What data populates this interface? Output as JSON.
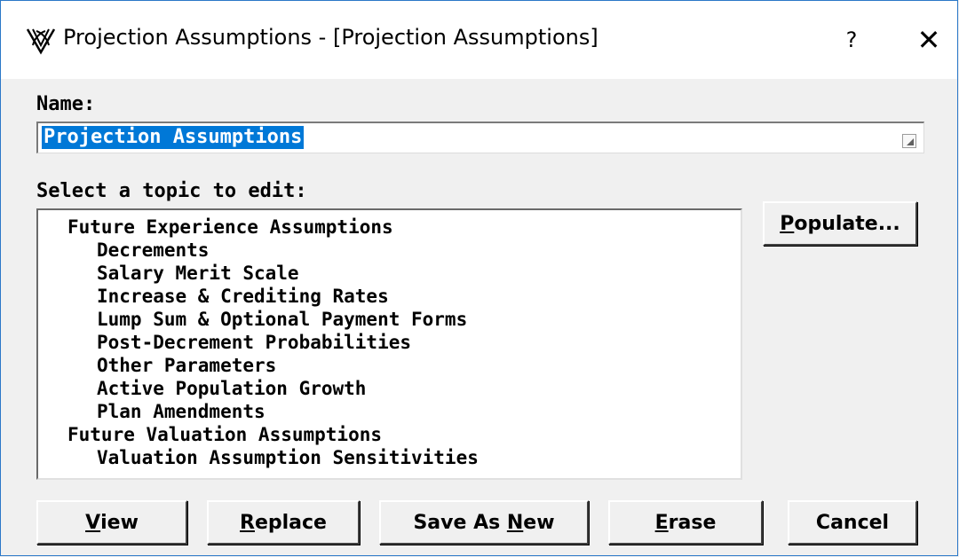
{
  "window": {
    "title": "Projection Assumptions - [Projection Assumptions]",
    "help_label": "?",
    "close_label": "✕"
  },
  "name_section": {
    "label": "Name:",
    "value": "Projection Assumptions"
  },
  "topic_section": {
    "label": "Select a topic to edit:",
    "items": [
      {
        "label": "Future Experience Assumptions",
        "level": 0
      },
      {
        "label": "Decrements",
        "level": 1
      },
      {
        "label": "Salary Merit Scale",
        "level": 1
      },
      {
        "label": "Increase & Crediting Rates",
        "level": 1
      },
      {
        "label": "Lump Sum & Optional Payment Forms",
        "level": 1
      },
      {
        "label": "Post-Decrement Probabilities",
        "level": 1
      },
      {
        "label": "Other Parameters",
        "level": 1
      },
      {
        "label": "Active Population Growth",
        "level": 1
      },
      {
        "label": "Plan Amendments",
        "level": 1
      },
      {
        "label": "Future Valuation Assumptions",
        "level": 0
      },
      {
        "label": "Valuation Assumption Sensitivities",
        "level": 1
      }
    ]
  },
  "buttons": {
    "populate": {
      "pre": "",
      "mnemonic": "P",
      "post": "opulate..."
    },
    "view": {
      "pre": "",
      "mnemonic": "V",
      "post": "iew"
    },
    "replace": {
      "pre": "",
      "mnemonic": "R",
      "post": "eplace"
    },
    "save_as_new": {
      "pre": "Save As ",
      "mnemonic": "N",
      "post": "ew"
    },
    "erase": {
      "pre": "",
      "mnemonic": "E",
      "post": "rase"
    },
    "cancel": {
      "pre": "Cancel",
      "mnemonic": "",
      "post": ""
    }
  },
  "colors": {
    "selection": "#0078d7",
    "window_border": "#2b78c8",
    "dialog_background": "#f0f0f0"
  },
  "icons": {
    "app": "app-logo-icon",
    "help": "help-icon",
    "close": "close-icon",
    "field": "field-browse-icon"
  }
}
